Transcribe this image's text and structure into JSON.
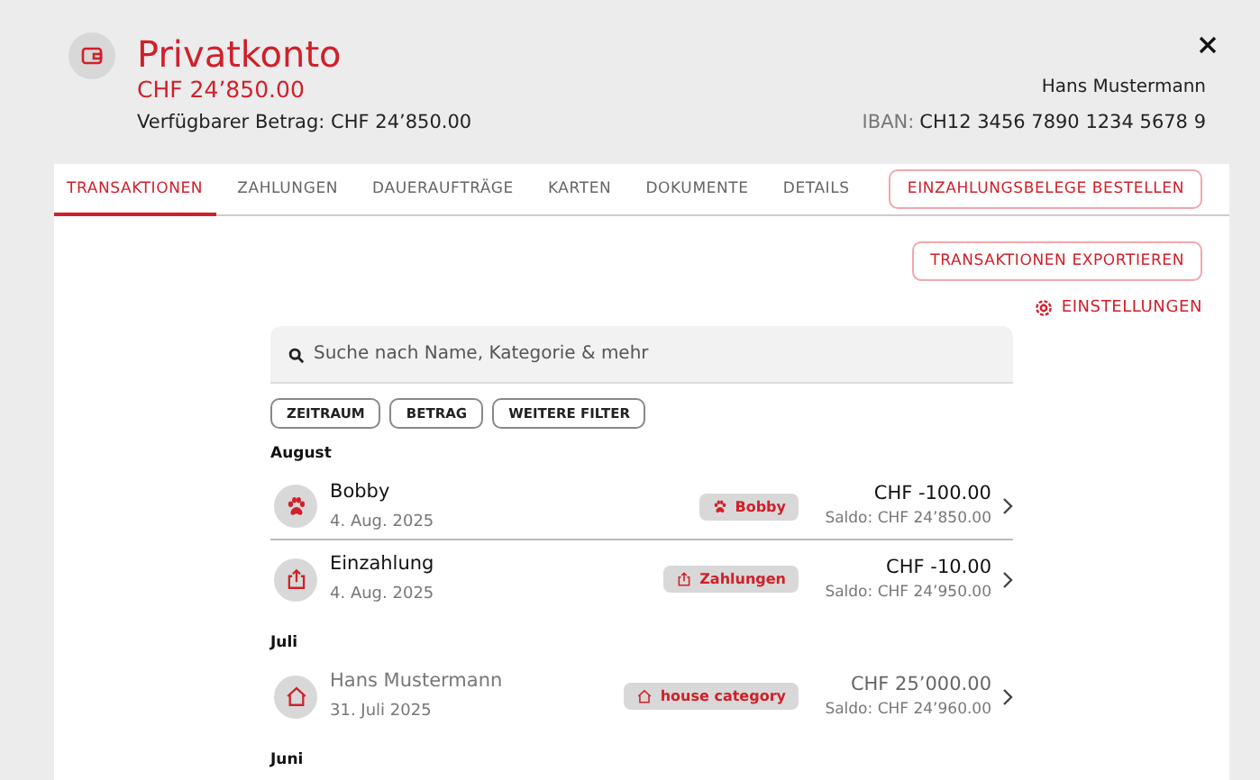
{
  "account": {
    "title": "Privatkonto",
    "balance": "CHF 24’850.00",
    "available": "Verfügbarer Betrag: CHF 24’850.00",
    "owner": "Hans Mustermann",
    "iban_label": "IBAN:",
    "iban": "CH12 3456 7890 1234 5678 9"
  },
  "tabs": [
    {
      "label": "TRANSAKTIONEN",
      "selected": true
    },
    {
      "label": "ZAHLUNGEN",
      "selected": false
    },
    {
      "label": "DAUERAUFTRÄGE",
      "selected": false
    },
    {
      "label": "KARTEN",
      "selected": false
    },
    {
      "label": "DOKUMENTE",
      "selected": false
    },
    {
      "label": "DETAILS",
      "selected": false
    }
  ],
  "order_button": "EINZAHLUNGSBELEGE BESTELLEN",
  "export_button": "TRANSAKTIONEN EXPORTIEREN",
  "settings_link": "EINSTELLUNGEN",
  "search": {
    "placeholder": "Suche nach Name, Kategorie & mehr"
  },
  "filters": [
    "ZEITRAUM",
    "BETRAG",
    "WEITERE FILTER"
  ],
  "groups": [
    {
      "month": "August",
      "transactions": [
        {
          "name": "Bobby",
          "date": "4. Aug. 2025",
          "kind": "paw",
          "category": "Bobby",
          "amount": "CHF -100.00",
          "saldo": "Saldo: CHF 24’850.00",
          "pending": false
        },
        {
          "name": "Einzahlung",
          "date": "4. Aug. 2025",
          "kind": "upload",
          "category": "Zahlungen",
          "amount": "CHF -10.00",
          "saldo": "Saldo: CHF 24’950.00",
          "pending": false
        }
      ]
    },
    {
      "month": "Juli",
      "transactions": [
        {
          "name": "Hans Mustermann",
          "date": "31. Juli 2025",
          "kind": "house",
          "category": "house category",
          "amount": "CHF 25’000.00",
          "saldo": "Saldo: CHF 24’960.00",
          "pending": true
        }
      ]
    },
    {
      "month": "Juni"
    }
  ]
}
